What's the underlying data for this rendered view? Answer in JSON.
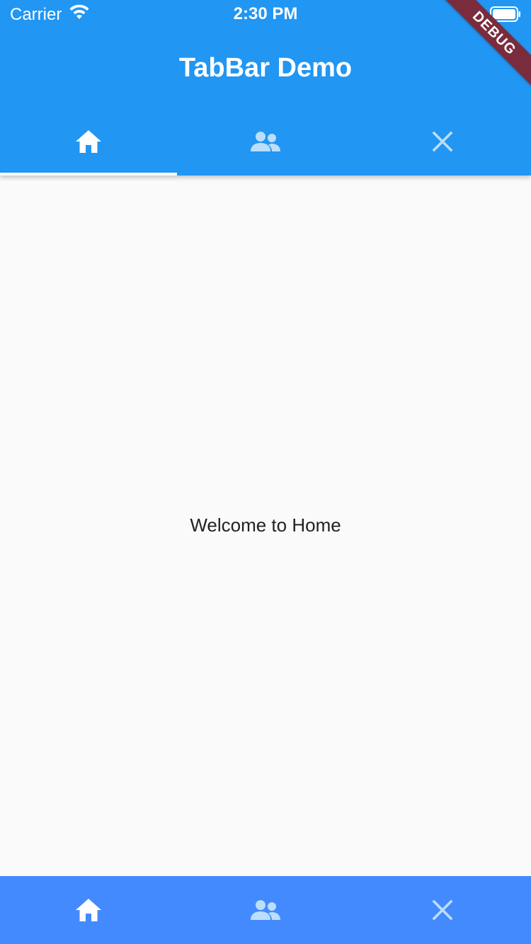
{
  "status_bar": {
    "carrier": "Carrier",
    "time": "2:30 PM",
    "wifi_icon": "wifi-icon",
    "battery_icon": "battery-icon"
  },
  "app_bar": {
    "title": "TabBar Demo",
    "background": "#2196f3"
  },
  "top_tabs": [
    {
      "icon": "home-icon",
      "selected": true
    },
    {
      "icon": "people-icon",
      "selected": false
    },
    {
      "icon": "close-icon",
      "selected": false
    }
  ],
  "debug_banner": "DEBUG",
  "content": {
    "text": "Welcome to Home"
  },
  "bottom_tabs": {
    "background": "#448aff",
    "items": [
      {
        "icon": "home-icon",
        "selected": true
      },
      {
        "icon": "people-icon",
        "selected": false
      },
      {
        "icon": "close-icon",
        "selected": false
      }
    ]
  },
  "colors": {
    "selected_icon": "#ffffff",
    "unselected_icon": "#bbdefb",
    "page_background": "#fafafa",
    "debug_banner": "#7a2c3c"
  }
}
